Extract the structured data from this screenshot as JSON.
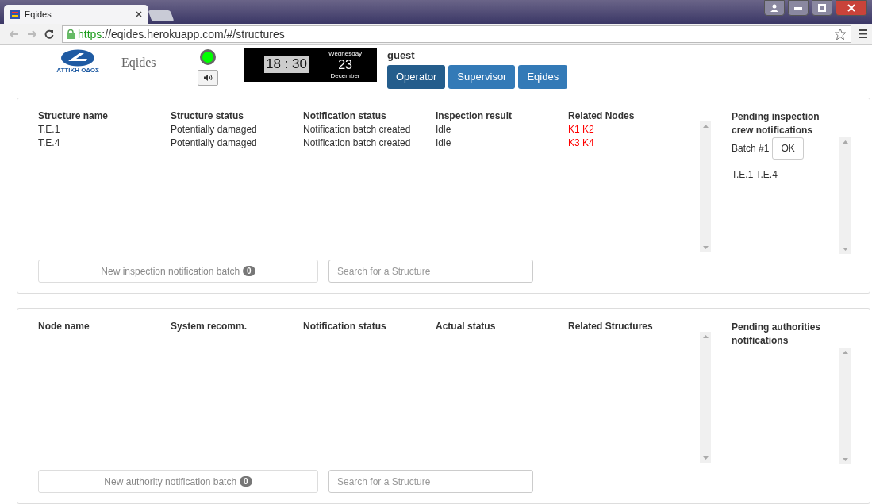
{
  "browser": {
    "tab_title": "Eqides",
    "url_scheme": "https",
    "url_rest": "://eqides.herokuapp.com/#/structures",
    "secure": true
  },
  "header": {
    "logo_text": "ΑΤΤΙΚΗ ΟΔΟΣ",
    "app_name": "Eqides",
    "connected": true,
    "clock": {
      "time": "18 : 30",
      "weekday": "Wednesday",
      "day": "23",
      "month": "December"
    },
    "user": "guest",
    "roles": [
      {
        "label": "Operator",
        "selected": true
      },
      {
        "label": "Supervisor",
        "selected": false
      },
      {
        "label": "Eqides",
        "selected": false
      }
    ]
  },
  "panels": [
    {
      "columns": [
        "Structure name",
        "Structure status",
        "Notification status",
        "Inspection result",
        "Related Nodes"
      ],
      "rows": [
        {
          "cells": [
            "T.E.1",
            "Potentially damaged",
            "Notification batch created",
            "Idle"
          ],
          "related": "K1 K2"
        },
        {
          "cells": [
            "T.E.4",
            "Potentially damaged",
            "Notification batch created",
            "Idle"
          ],
          "related": "K3 K4"
        }
      ],
      "side_title": "Pending inspection crew notifications",
      "batches": [
        {
          "label": "Batch #1",
          "button": "OK",
          "items": "T.E.1 T.E.4"
        }
      ],
      "batch_button": {
        "label": "New inspection notification batch",
        "count": "0"
      },
      "search": {
        "placeholder": "Search for a Structure"
      }
    },
    {
      "columns": [
        "Node name",
        "System recomm.",
        "Notification status",
        "Actual status",
        "Related Structures"
      ],
      "side_title": "Pending authorities notifications",
      "batch_button": {
        "label": "New authority notification batch",
        "count": "0"
      },
      "search": {
        "placeholder": "Search for a Structure"
      }
    }
  ]
}
